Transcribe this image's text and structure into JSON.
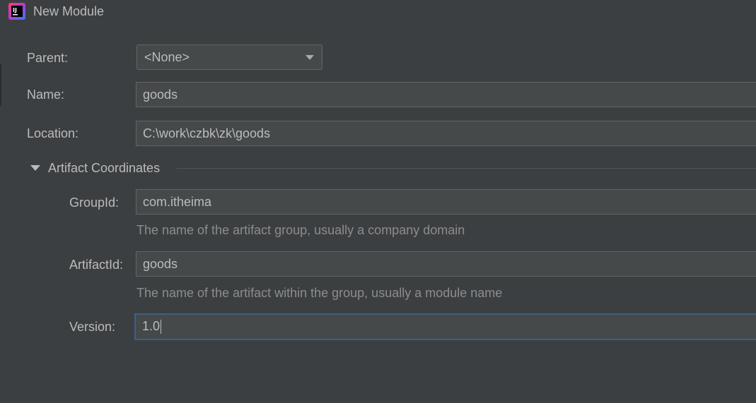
{
  "window": {
    "title": "New Module",
    "app_icon": "intellij-idea-icon",
    "app_icon_text": "IJ"
  },
  "form": {
    "parent": {
      "label": "Parent:",
      "value": "<None>"
    },
    "name": {
      "label": "Name:",
      "value": "goods"
    },
    "location": {
      "label": "Location:",
      "value": "C:\\work\\czbk\\zk\\goods"
    }
  },
  "artifact": {
    "section_title": "Artifact Coordinates",
    "groupId": {
      "label": "GroupId:",
      "value": "com.itheima",
      "hint": "The name of the artifact group, usually a company domain"
    },
    "artifactId": {
      "label": "ArtifactId:",
      "value": "goods",
      "hint": "The name of the artifact within the group, usually a module name"
    },
    "version": {
      "label": "Version:",
      "value": "1.0"
    }
  },
  "colors": {
    "background": "#3c3f41",
    "field_background": "#45494a",
    "field_border": "#646464",
    "focus_border": "#3d6185",
    "text": "#bbbbbb",
    "hint_text": "#8c8c8c"
  }
}
